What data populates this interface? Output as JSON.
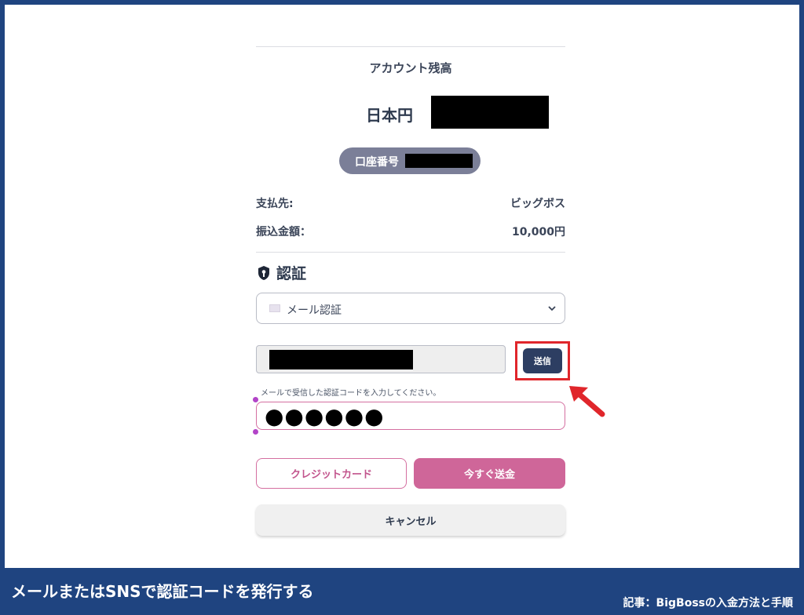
{
  "account": {
    "balance_label": "アカウント残高",
    "currency": "日本円",
    "account_number_label": "口座番号"
  },
  "payment": {
    "payee_label": "支払先:",
    "payee_value": "ビッグボス",
    "amount_label": "振込金額：",
    "amount_value": "10,000円"
  },
  "auth": {
    "heading": "認証",
    "method_selected": "メール認証",
    "send_label": "送信",
    "hint": "メールで受信した認証コードを入力してください。",
    "code_masked": "●●●●●●"
  },
  "buttons": {
    "credit_card": "クレジットカード",
    "send_now": "今すぐ送金",
    "cancel": "キャンセル"
  },
  "caption": {
    "title": "メールまたはSNSで認証コードを発行する",
    "source": "記事：BigBossの入金方法と手順"
  },
  "colors": {
    "frame": "#1f4480",
    "accent_pink": "#cf6699",
    "send_button": "#2d3e62",
    "highlight": "#e0262b"
  }
}
